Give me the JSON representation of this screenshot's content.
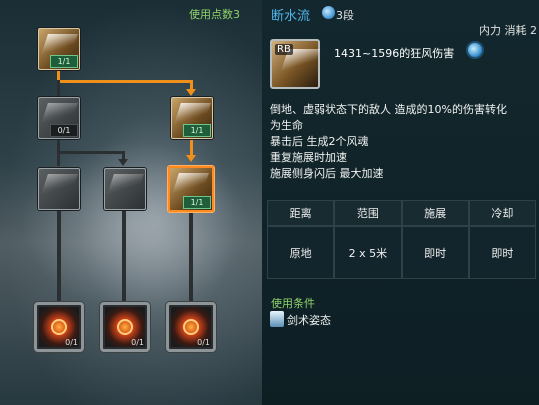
{
  "tree": {
    "points_label": "使用点数3",
    "nodes": [
      {
        "id": "root",
        "badge": "1/1",
        "state": "active"
      },
      {
        "id": "t2-left",
        "badge": "0/1",
        "state": "locked"
      },
      {
        "id": "t2-right",
        "badge": "1/1",
        "state": "active"
      },
      {
        "id": "t3-a",
        "badge": "",
        "state": "locked"
      },
      {
        "id": "t3-b",
        "badge": "",
        "state": "locked"
      },
      {
        "id": "t3-c",
        "badge": "1/1",
        "state": "selected"
      },
      {
        "id": "t4-a",
        "badge": "0/1",
        "state": "locked"
      },
      {
        "id": "t4-b",
        "badge": "0/1",
        "state": "locked"
      },
      {
        "id": "t4-c",
        "badge": "0/1",
        "state": "locked"
      }
    ]
  },
  "skill": {
    "name": "断水流",
    "stage": "3段",
    "cost": "内力 消耗 2",
    "hotkey": "RB",
    "damage": "1431~1596的狂风伤害",
    "description": [
      "倒地、虚弱状态下的敌人 造成的10%的伤害转化",
      "为生命",
      "暴击后 生成2个风魂",
      "重复施展时加速",
      "施展侧身闪后 最大加速"
    ],
    "table": {
      "headers": [
        "距离",
        "范围",
        "施展",
        "冷却"
      ],
      "values": [
        "原地",
        "2 x 5米",
        "即时",
        "即时"
      ]
    },
    "condition_title": "使用条件",
    "condition": "剑术姿态"
  },
  "colors": {
    "name": "#4fb3e6",
    "accent_green": "#8fd36a",
    "path_active": "#f0901a",
    "selected_border": "#ff8a1f"
  }
}
